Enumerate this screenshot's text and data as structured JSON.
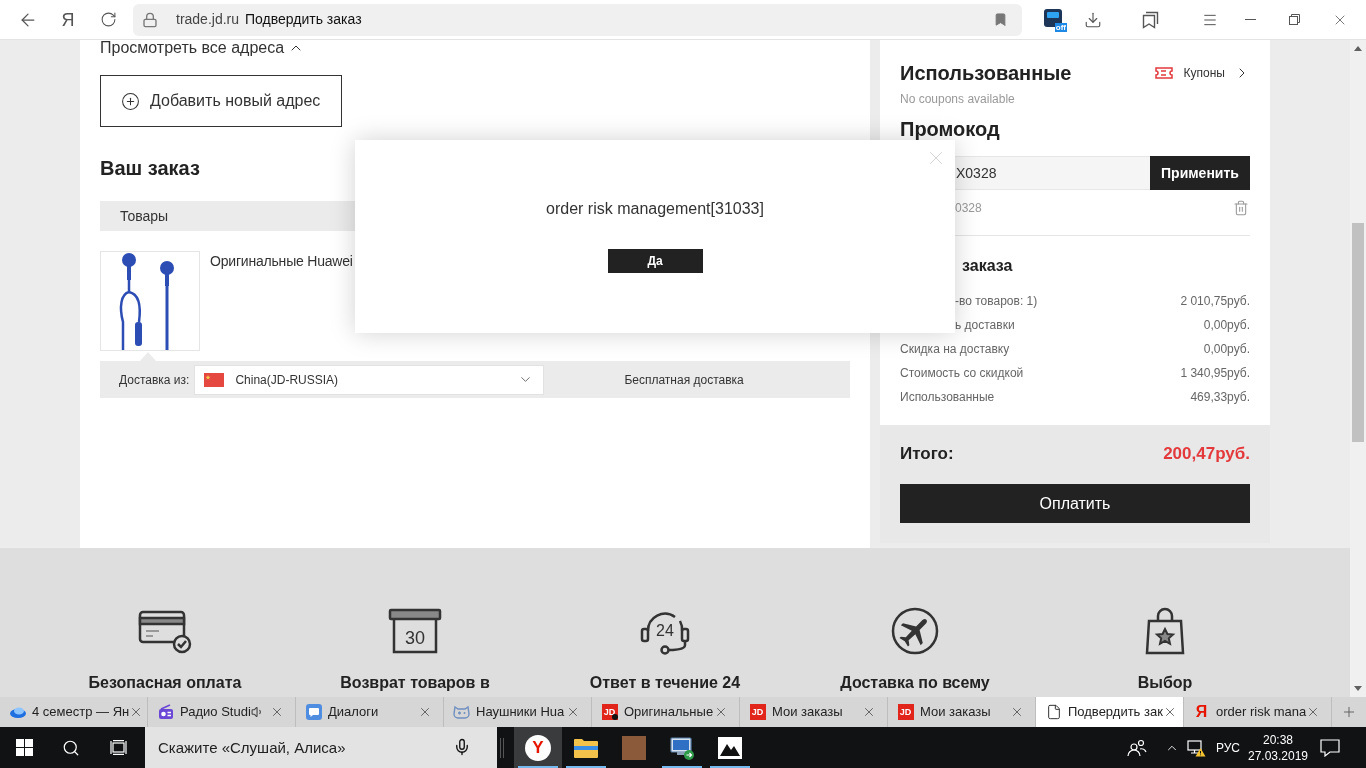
{
  "browser": {
    "logo": "Я",
    "domain": "trade.jd.ru",
    "page_title": "Подвердить заказ",
    "extension_badge": "off"
  },
  "addresses": {
    "view_all": "Просмотреть все адреса",
    "add_button": "Добавить новый адрес"
  },
  "order": {
    "title": "Ваш заказ",
    "items_header": "Товары",
    "product_title": "Оригинальные Huawei",
    "delivery_label": "Доставка из:",
    "delivery_origin": "China(JD-RUSSIA)",
    "delivery_method": "Бесплатная доставка"
  },
  "coupons": {
    "title": "Использованные",
    "link": "Купоны",
    "note": "No coupons available"
  },
  "promo": {
    "title": "Промокод",
    "value": "X0328",
    "apply_button": "Применить",
    "applied_code": "0328"
  },
  "summary": {
    "title": "заказа",
    "rows": [
      {
        "label": "-во товаров: 1)",
        "value": "2 010,75руб."
      },
      {
        "label": "ь доставки",
        "value": "0,00руб."
      },
      {
        "label": "Скидка на доставку",
        "value": "0,00руб."
      },
      {
        "label": "Стоимость со скидкой",
        "value": "1 340,95руб."
      },
      {
        "label": "Использованные",
        "value": "469,33руб."
      }
    ],
    "total_label": "Итого:",
    "total_value": "200,47руб.",
    "pay_button": "Оплатить"
  },
  "features": [
    {
      "kind": "card",
      "label": "Безопасная оплата"
    },
    {
      "kind": "box",
      "badge": "30",
      "label": "Возврат товаров в"
    },
    {
      "kind": "headset",
      "badge": "24",
      "label": "Ответ в течение 24"
    },
    {
      "kind": "plane",
      "label": "Доставка по всему"
    },
    {
      "kind": "bag",
      "label": "Выбор"
    }
  ],
  "dialog": {
    "message": "order risk management[31033]",
    "ok_button": "Да"
  },
  "tabs": [
    {
      "kind": "saucer",
      "title": "4 семестр — Ян",
      "audio": false,
      "dot": false,
      "selected": false
    },
    {
      "kind": "radio",
      "title": "Радио Studi",
      "audio": true,
      "dot": false,
      "selected": false
    },
    {
      "kind": "chat",
      "title": "Диалоги",
      "audio": false,
      "dot": false,
      "selected": false
    },
    {
      "kind": "gamepad",
      "title": "Наушники Hua",
      "audio": false,
      "dot": false,
      "selected": false
    },
    {
      "kind": "jd",
      "icon_text": "JD",
      "title": "Оригинальные",
      "audio": false,
      "dot": true,
      "selected": false
    },
    {
      "kind": "jd",
      "icon_text": "JD",
      "title": "Мои заказы",
      "audio": false,
      "dot": false,
      "selected": false
    },
    {
      "kind": "jd",
      "icon_text": "JD",
      "title": "Мои заказы",
      "audio": false,
      "dot": false,
      "selected": false
    },
    {
      "kind": "page",
      "title": "Подвердить зак",
      "audio": false,
      "dot": false,
      "selected": true
    },
    {
      "kind": "yandex",
      "icon_text": "Я",
      "title": "order risk mana",
      "audio": false,
      "dot": false,
      "selected": false
    }
  ],
  "taskbar": {
    "search_placeholder": "Скажите «Слушай, Алиса»",
    "apps": [
      {
        "kind": "browser",
        "glyph": "Y",
        "active": true,
        "running": true
      },
      {
        "kind": "folder",
        "active": false,
        "running": true
      },
      {
        "kind": "photo",
        "active": false,
        "running": false
      },
      {
        "kind": "network",
        "active": false,
        "running": true
      },
      {
        "kind": "image",
        "active": false,
        "running": true
      }
    ],
    "language": "РУС",
    "time": "20:38",
    "date": "27.03.2019"
  }
}
